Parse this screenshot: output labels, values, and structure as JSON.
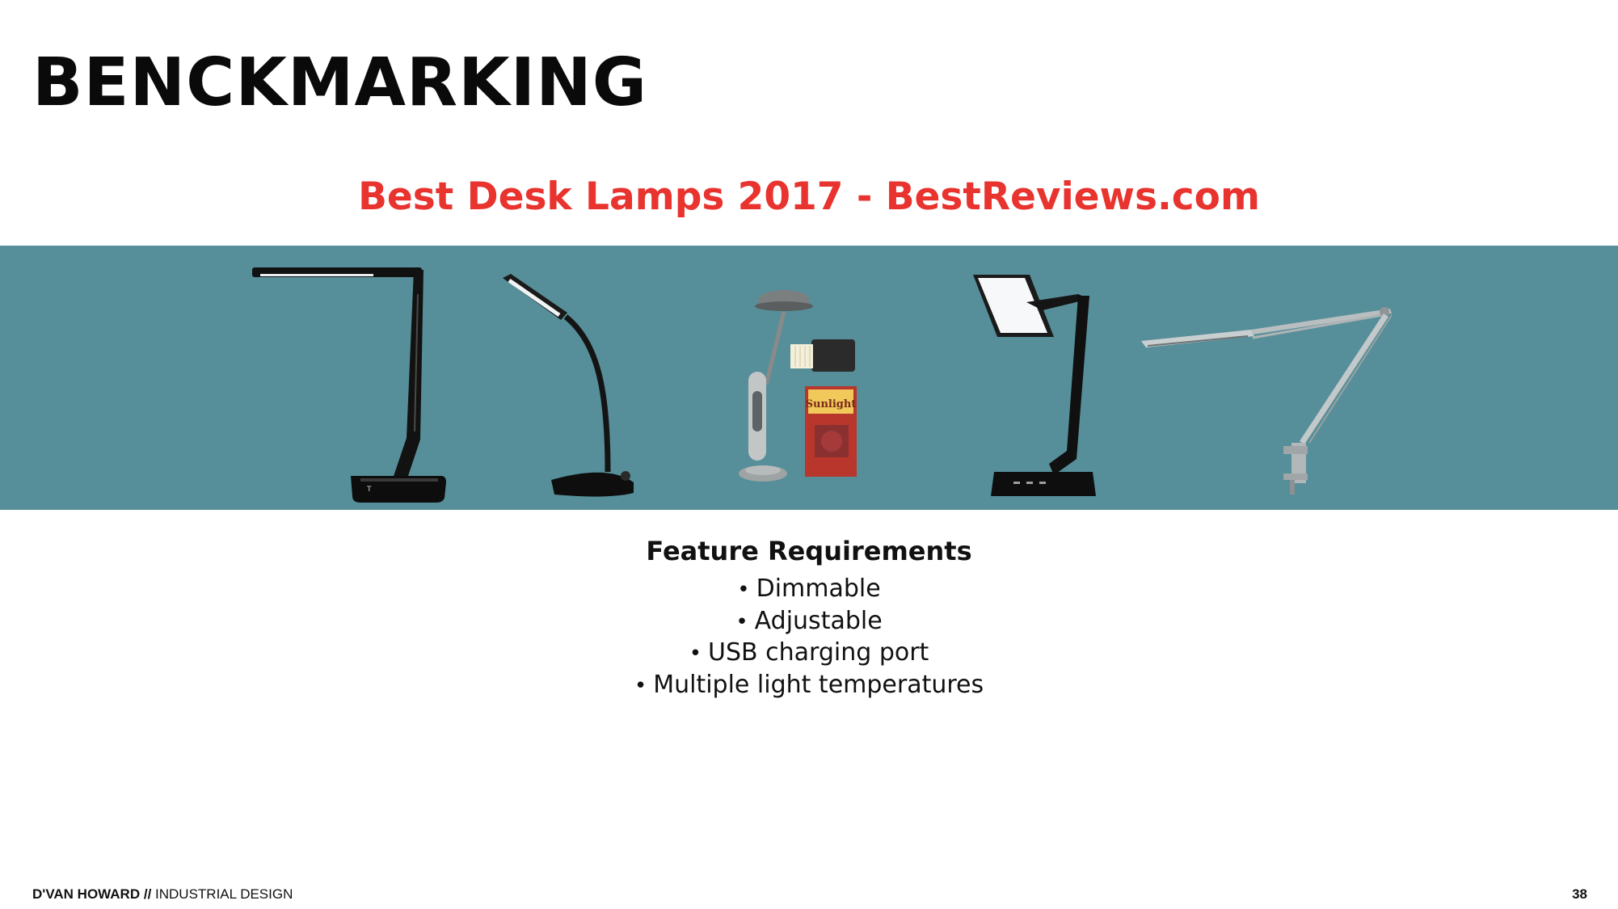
{
  "slide": {
    "title": "BENCKMARKING",
    "subtitle": "Best Desk Lamps 2017 - BestReviews.com",
    "accent_color": "#e8332e",
    "band_color": "#568f99"
  },
  "products": [
    {
      "icon": "folding-led-desk-lamp-icon"
    },
    {
      "icon": "gooseneck-desk-lamp-icon"
    },
    {
      "icon": "sunlight-lamp-with-box-icon",
      "box_text": "Sunlight"
    },
    {
      "icon": "tablet-panel-desk-lamp-icon"
    },
    {
      "icon": "architect-clamp-lamp-icon"
    }
  ],
  "features": {
    "heading": "Feature Requirements",
    "items": [
      "Dimmable",
      "Adjustable",
      "USB charging port",
      "Multiple light temperatures"
    ]
  },
  "footer": {
    "author": "D'VAN HOWARD",
    "separator": " // ",
    "department": "INDUSTRIAL DESIGN",
    "page_number": "38"
  }
}
